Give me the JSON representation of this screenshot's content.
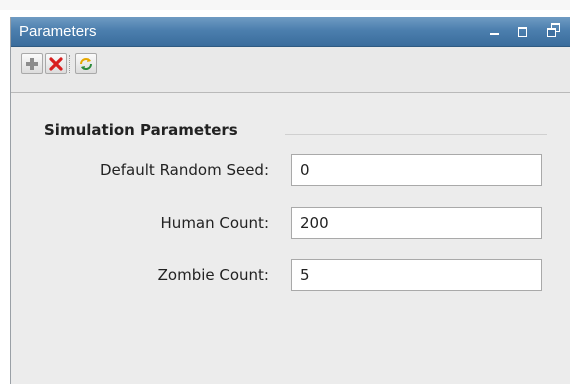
{
  "panel": {
    "title": "Parameters",
    "window_controls": [
      "minimize-icon",
      "maximize-icon",
      "restore-icon"
    ]
  },
  "toolbar": {
    "buttons": [
      {
        "name": "add",
        "icon": "plus-icon"
      },
      {
        "name": "remove",
        "icon": "red-x-icon"
      },
      {
        "name": "refresh",
        "icon": "refresh-arrows-icon"
      }
    ]
  },
  "section": {
    "title": "Simulation Parameters",
    "fields": [
      {
        "label": "Default Random Seed:",
        "value": "0"
      },
      {
        "label": "Human Count:",
        "value": "200"
      },
      {
        "label": "Zombie Count:",
        "value": "5"
      }
    ]
  },
  "colors": {
    "titlebar": "#4c7fae",
    "remove_icon": "#d82020",
    "refresh_icon": "#e6a800"
  }
}
